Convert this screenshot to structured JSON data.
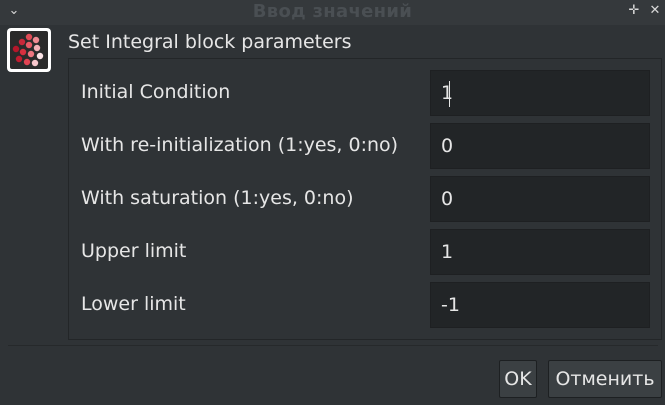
{
  "window": {
    "title": "Ввод значений",
    "menu_glyph": "⌄",
    "pin_glyph": "✛",
    "close_glyph": "✕"
  },
  "app_icon": "scilab-xcos-icon",
  "header": {
    "text": "Set Integral block parameters"
  },
  "fields": [
    {
      "label": "Initial Condition",
      "value": "1"
    },
    {
      "label": "With re-initialization (1:yes, 0:no)",
      "value": "0"
    },
    {
      "label": "With saturation (1:yes, 0:no)",
      "value": "0"
    },
    {
      "label": "Upper limit",
      "value": "1"
    },
    {
      "label": "Lower limit",
      "value": "-1"
    }
  ],
  "buttons": {
    "ok": "OK",
    "cancel": "Отменить"
  },
  "colors": {
    "background": "#2f3336",
    "input_bg": "#222527",
    "text": "#e6e6e6"
  }
}
